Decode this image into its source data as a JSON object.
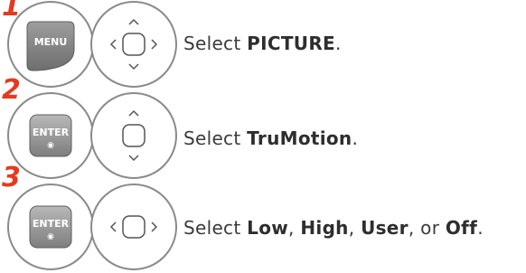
{
  "steps": [
    {
      "number": "1",
      "button_label": "MENU",
      "instruction": {
        "prefix": "Select ",
        "bold1": "PICTURE",
        "suffix": "."
      }
    },
    {
      "number": "2",
      "button_label": "ENTER",
      "button_symbol": "◉",
      "instruction": {
        "prefix": "Select ",
        "bold1": "TruMotion",
        "suffix": "."
      }
    },
    {
      "number": "3",
      "button_label": "ENTER",
      "button_symbol": "◉",
      "instruction": {
        "prefix": "Select ",
        "bold1": "Low",
        "sep1": ", ",
        "bold2": "High",
        "sep2": ", ",
        "bold3": "User",
        "sep3": ", or ",
        "bold4": "Off",
        "suffix": "."
      }
    }
  ],
  "colors": {
    "step_number": "#e53a1f",
    "circle_outline": "#8a8a8a",
    "menu_button": "#8c8c8c",
    "enter_button": "#9a9a9a",
    "text": "#3b3b3b"
  }
}
